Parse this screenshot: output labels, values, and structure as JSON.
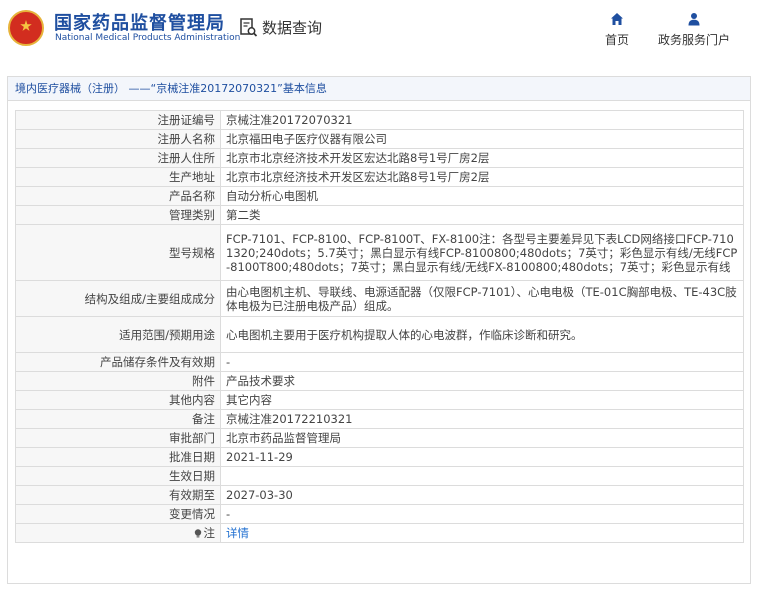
{
  "header": {
    "site_name_cn": "国家药品监督管理局",
    "site_name_en": "National Medical Products Administration",
    "search_label": "数据查询",
    "nav_home": "首页",
    "nav_service": "政务服务门户",
    "brand_color": "#1f4fa0"
  },
  "breadcrumb": "境内医疗器械（注册） ——“京械注准20172070321”基本信息",
  "rows": [
    {
      "label": "注册证编号",
      "value": "京械注准20172070321"
    },
    {
      "label": "注册人名称",
      "value": "北京福田电子医疗仪器有限公司"
    },
    {
      "label": "注册人住所",
      "value": "北京市北京经济技术开发区宏达北路8号1号厂房2层"
    },
    {
      "label": "生产地址",
      "value": "北京市北京经济技术开发区宏达北路8号1号厂房2层"
    },
    {
      "label": "产品名称",
      "value": "自动分析心电图机"
    },
    {
      "label": "管理类别",
      "value": "第二类"
    },
    {
      "label": "型号规格",
      "value": "FCP-7101、FCP-8100、FCP-8100T、FX-8100注：各型号主要差异见下表LCD网络接口FCP-7101320;240dots；5.7英寸；黑白显示有线FCP-8100800;480dots；7英寸；彩色显示有线/无线FCP-8100T800;480dots；7英寸；黑白显示有线/无线FX-8100800;480dots；7英寸；彩色显示有线"
    },
    {
      "label": "结构及组成/主要组成成分",
      "value": "由心电图机主机、导联线、电源适配器（仅限FCP-7101）、心电电极（TE-01C胸部电极、TE-43C肢体电极为已注册电极产品）组成。"
    },
    {
      "label": "适用范围/预期用途",
      "value": "心电图机主要用于医疗机构提取人体的心电波群，作临床诊断和研究。"
    },
    {
      "label": "产品储存条件及有效期",
      "value": "-"
    },
    {
      "label": "附件",
      "value": "产品技术要求"
    },
    {
      "label": "其他内容",
      "value": "其它内容"
    },
    {
      "label": "备注",
      "value": "京械注准20172210321"
    },
    {
      "label": "审批部门",
      "value": "北京市药品监督管理局"
    },
    {
      "label": "批准日期",
      "value": "2021-11-29"
    },
    {
      "label": "生效日期",
      "value": ""
    },
    {
      "label": "有效期至",
      "value": "2027-03-30"
    },
    {
      "label": "变更情况",
      "value": "-"
    },
    {
      "label": "注",
      "value": "详情"
    }
  ]
}
